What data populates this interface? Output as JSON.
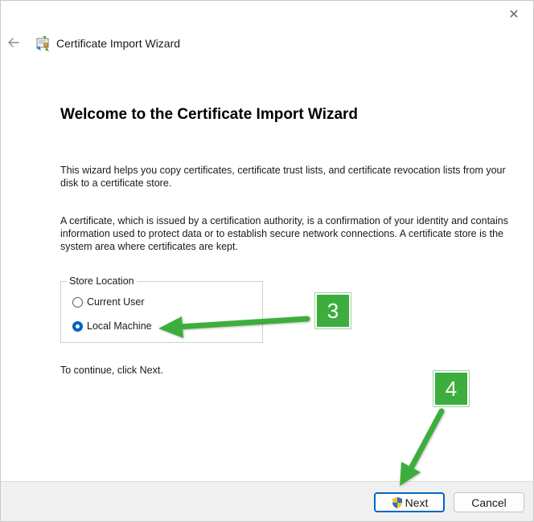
{
  "window": {
    "title": "Certificate Import Wizard",
    "close_glyph": "✕"
  },
  "content": {
    "heading": "Welcome to the Certificate Import Wizard",
    "paragraph1": "This wizard helps you copy certificates, certificate trust lists, and certificate revocation lists from your disk to a certificate store.",
    "paragraph2": "A certificate, which is issued by a certification authority, is a confirmation of your identity and contains information used to protect data or to establish secure network connections. A certificate store is the system area where certificates are kept.",
    "store_location": {
      "legend": "Store Location",
      "options": [
        {
          "label": "Current User",
          "selected": false
        },
        {
          "label": "Local Machine",
          "selected": true
        }
      ]
    },
    "continue_text": "To continue, click Next."
  },
  "footer": {
    "next_label": "Next",
    "cancel_label": "Cancel"
  },
  "annotations": {
    "step3": "3",
    "step4": "4",
    "color": "#3dae3e"
  },
  "icons": {
    "back": "back-arrow-icon",
    "wizard": "certificate-wizard-icon",
    "shield": "uac-shield-icon",
    "close": "close-icon"
  }
}
